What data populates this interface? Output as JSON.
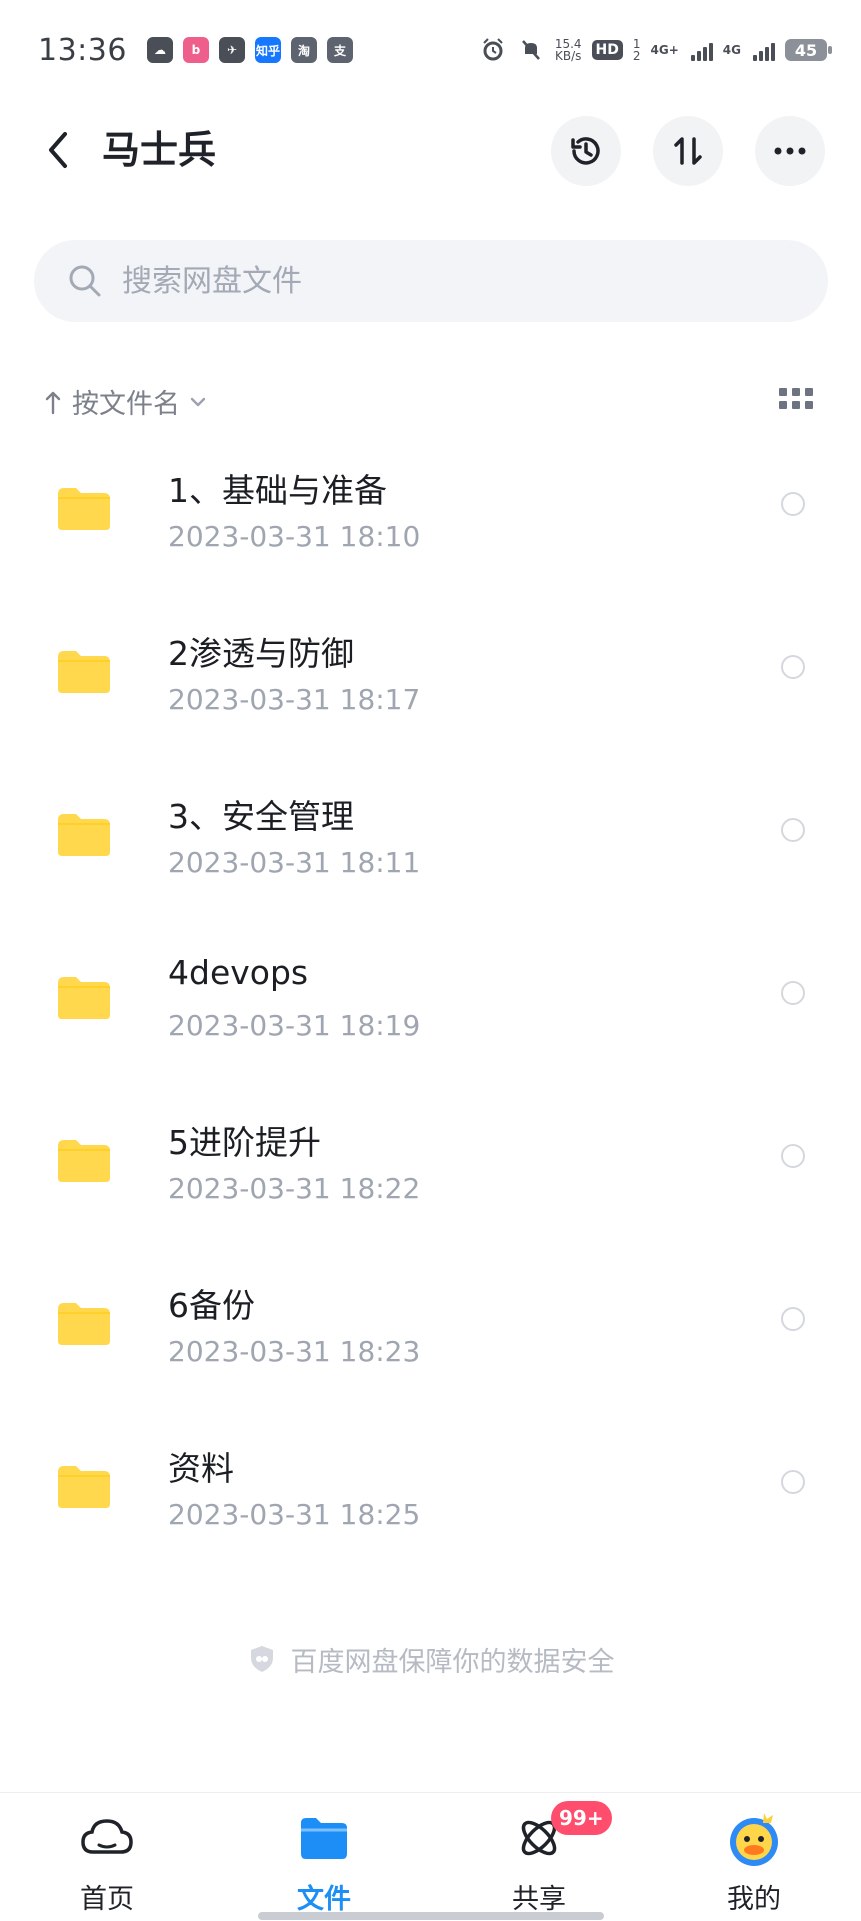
{
  "status_bar": {
    "time": "13:36",
    "apps": [
      "cloud",
      "bilibili",
      "bird",
      "知乎",
      "淘",
      "支"
    ],
    "network_speed_value": "15.4",
    "network_speed_unit": "KB/s",
    "hd_label": "HD",
    "hd_index_top": "1",
    "hd_index_bottom": "2",
    "net_1": "4G+",
    "net_2": "4G",
    "battery": "45"
  },
  "header": {
    "title": "马士兵"
  },
  "search": {
    "placeholder": "搜索网盘文件"
  },
  "sort": {
    "label": "按文件名"
  },
  "files": [
    {
      "name": "1、基础与准备",
      "date": "2023-03-31  18:10"
    },
    {
      "name": "2渗透与防御",
      "date": "2023-03-31  18:17"
    },
    {
      "name": "3、安全管理",
      "date": "2023-03-31  18:11"
    },
    {
      "name": "4devops",
      "date": "2023-03-31  18:19"
    },
    {
      "name": "5进阶提升",
      "date": "2023-03-31  18:22"
    },
    {
      "name": "6备份",
      "date": "2023-03-31  18:23"
    },
    {
      "name": "资料",
      "date": "2023-03-31  18:25"
    }
  ],
  "footer": {
    "security_note": "百度网盘保障你的数据安全"
  },
  "bottom_nav": {
    "items": [
      {
        "label": "首页",
        "icon": "cloud-icon"
      },
      {
        "label": "文件",
        "icon": "file-folder-icon"
      },
      {
        "label": "共享",
        "icon": "share-atom-icon"
      },
      {
        "label": "我的",
        "icon": "profile-avatar-icon"
      }
    ],
    "share_badge": "99+"
  },
  "colors": {
    "accent": "#1c8ef5",
    "folder": "#ffd84d",
    "badge": "#ff4d6d",
    "text_secondary": "#a0a6b1"
  }
}
